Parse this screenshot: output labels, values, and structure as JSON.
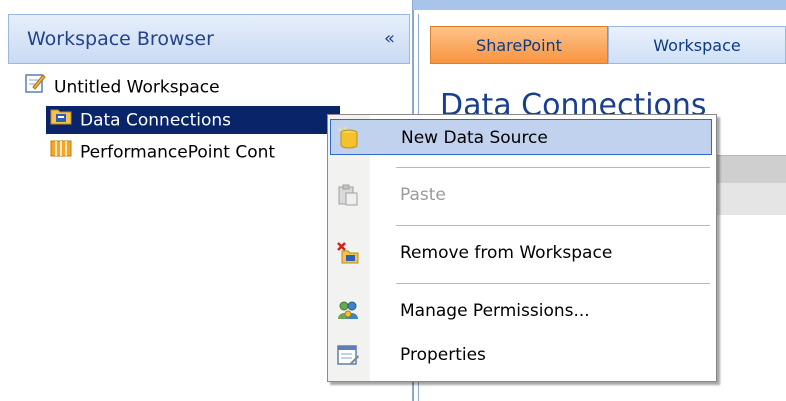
{
  "workspace_browser": {
    "title": "Workspace Browser",
    "collapse_glyph": "«",
    "tree": {
      "workspace": "Untitled Workspace",
      "data_connections": "Data Connections",
      "performancepoint_content": "PerformancePoint Cont"
    }
  },
  "tabs": [
    "SharePoint",
    "Workspace"
  ],
  "page_title": "Data Connections",
  "context_menu": {
    "items": [
      {
        "label": "New Data Source",
        "icon": "database-new-icon",
        "highlighted": true,
        "enabled": true
      },
      {
        "label": "Paste",
        "icon": "paste-icon",
        "enabled": false
      },
      {
        "label": "Remove from Workspace",
        "icon": "remove-icon",
        "enabled": true
      },
      {
        "label": "Manage Permissions...",
        "icon": "permissions-icon",
        "enabled": true
      },
      {
        "label": "Properties",
        "icon": "properties-icon",
        "enabled": true
      }
    ]
  },
  "colors": {
    "selection": "#0a246a",
    "menu_highlight": "#c1d2ee",
    "active_tab": "#f8943e",
    "header_text": "#22438c"
  }
}
